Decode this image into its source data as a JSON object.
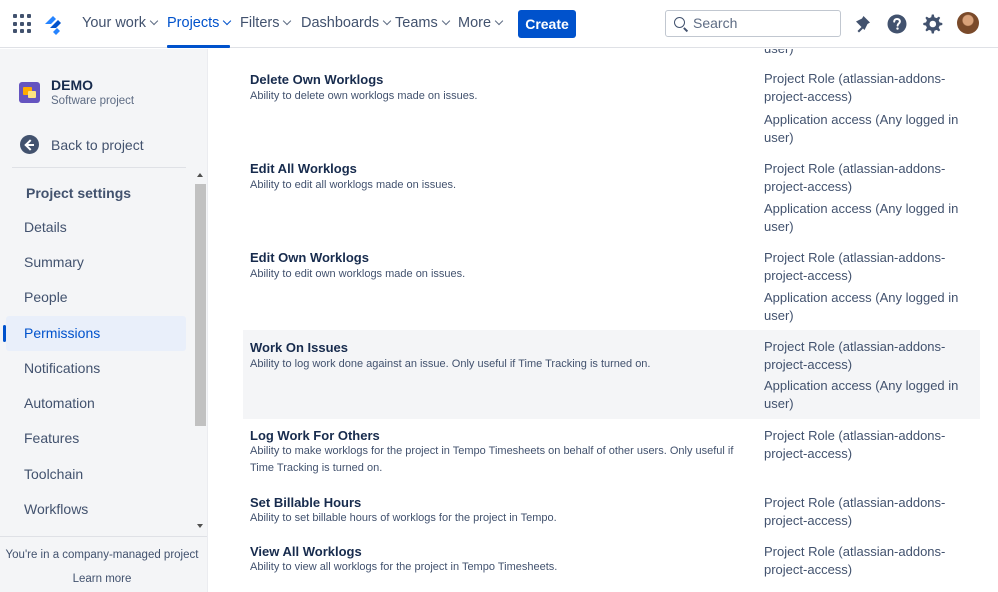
{
  "topnav": {
    "items": [
      {
        "label": "Your work"
      },
      {
        "label": "Projects"
      },
      {
        "label": "Filters"
      },
      {
        "label": "Dashboards"
      },
      {
        "label": "Teams"
      },
      {
        "label": "More"
      }
    ],
    "create_label": "Create",
    "search_placeholder": "Search",
    "icons": [
      "app-switcher-icon",
      "jira-logo-icon",
      "notifications-icon",
      "help-icon",
      "settings-icon"
    ],
    "accent_color": "#0052cc"
  },
  "sidebar": {
    "project_name": "DEMO",
    "project_type": "Software project",
    "back_label": "Back to project",
    "heading": "Project settings",
    "items": [
      {
        "label": "Details"
      },
      {
        "label": "Summary"
      },
      {
        "label": "People"
      },
      {
        "label": "Permissions"
      },
      {
        "label": "Notifications"
      },
      {
        "label": "Automation"
      },
      {
        "label": "Features"
      },
      {
        "label": "Toolchain"
      },
      {
        "label": "Workflows"
      }
    ],
    "active_item": "Permissions",
    "footer_text": "You're in a company-managed project",
    "footer_link": "Learn more"
  },
  "main": {
    "top_partial_grant": "user)",
    "permissions": [
      {
        "name": "Delete Own Worklogs",
        "description": "Ability to delete own worklogs made on issues.",
        "grants": [
          "Project Role (atlassian-addons-project-access)",
          "Application access (Any logged in user)"
        ]
      },
      {
        "name": "Edit All Worklogs",
        "description": "Ability to edit all worklogs made on issues.",
        "grants": [
          "Project Role (atlassian-addons-project-access)",
          "Application access (Any logged in user)"
        ]
      },
      {
        "name": "Edit Own Worklogs",
        "description": "Ability to edit own worklogs made on issues.",
        "grants": [
          "Project Role (atlassian-addons-project-access)",
          "Application access (Any logged in user)"
        ]
      },
      {
        "name": "Work On Issues",
        "description": "Ability to log work done against an issue. Only useful if Time Tracking is turned on.",
        "grants": [
          "Project Role (atlassian-addons-project-access)",
          "Application access (Any logged in user)"
        ]
      },
      {
        "name": "Log Work For Others",
        "description": "Ability to make worklogs for the project in Tempo Timesheets on behalf of other users. Only useful if Time Tracking is turned on.",
        "grants": [
          "Project Role (atlassian-addons-project-access)"
        ]
      },
      {
        "name": "Set Billable Hours",
        "description": "Ability to set billable hours of worklogs for the project in Tempo.",
        "grants": [
          "Project Role (atlassian-addons-project-access)"
        ]
      },
      {
        "name": "View All Worklogs",
        "description": "Ability to view all worklogs for the project in Tempo Timesheets.",
        "grants": [
          "Project Role (atlassian-addons-project-access)"
        ]
      }
    ]
  }
}
